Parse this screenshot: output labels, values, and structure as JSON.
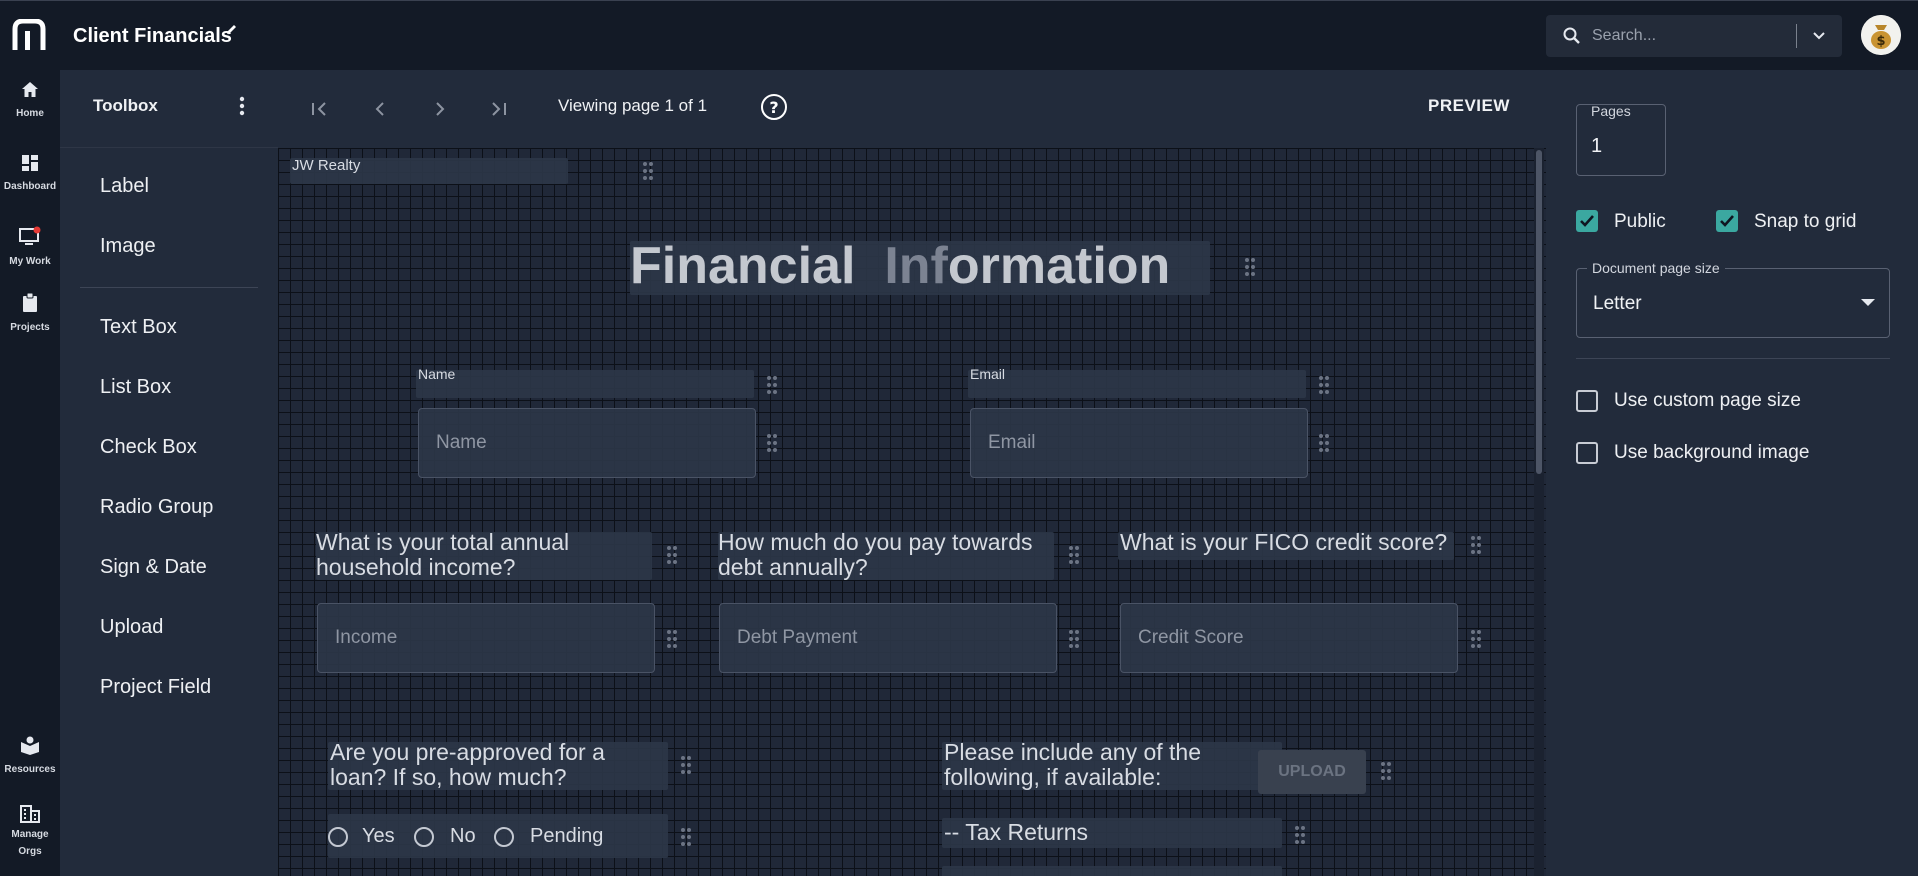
{
  "header": {
    "title": "Client Financials",
    "search_placeholder": "Search..."
  },
  "rail": {
    "items": [
      {
        "label": "Home",
        "icon": "home-icon"
      },
      {
        "label": "Dashboard",
        "icon": "dashboard-icon"
      },
      {
        "label": "My Work",
        "icon": "monitor-icon"
      },
      {
        "label": "Projects",
        "icon": "clipboard-icon"
      },
      {
        "label": "Resources",
        "icon": "book-icon"
      },
      {
        "label_line1": "Manage",
        "label_line2": "Orgs",
        "icon": "building-icon"
      }
    ]
  },
  "toolbox": {
    "title": "Toolbox",
    "items": [
      "Label",
      "Image",
      "Text Box",
      "List Box",
      "Check Box",
      "Radio Group",
      "Sign & Date",
      "Upload",
      "Project Field"
    ]
  },
  "canvas_header": {
    "page_info": "Viewing page 1 of 1",
    "preview_label": "PREVIEW"
  },
  "form": {
    "company": "JW Realty",
    "title_part1": "Financial",
    "title_part2": "Inf",
    "title_part3": "ormation",
    "name_label": "Name",
    "name_placeholder": "Name",
    "email_label": "Email",
    "email_placeholder": "Email",
    "income_question_line1": "What is your total annual",
    "income_question_line2": "household income?",
    "income_placeholder": "Income",
    "debt_question_line1": "How much do you pay towards",
    "debt_question_line2": "debt annually?",
    "debt_placeholder": "Debt Payment",
    "fico_question": "What is your FICO credit score?",
    "fico_placeholder": "Credit Score",
    "loan_question_line1": "Are you pre-approved for a",
    "loan_question_line2": "loan? If so, how much?",
    "radio_options": [
      "Yes",
      "No",
      "Pending"
    ],
    "include_line1": "Please include any of the",
    "include_line2": "following, if available:",
    "upload_label": "UPLOAD",
    "item_tax": "-- Tax Returns"
  },
  "properties": {
    "pages_label": "Pages",
    "pages_value": "1",
    "public_label": "Public",
    "public_checked": true,
    "snap_label": "Snap to grid",
    "snap_checked": true,
    "page_size_label": "Document page size",
    "page_size_value": "Letter",
    "custom_size_label": "Use custom page size",
    "custom_size_checked": false,
    "background_label": "Use background image",
    "background_checked": false
  },
  "colors": {
    "accent_checkbox": "#3ba8a0",
    "background": "#151b27",
    "panel": "#222b3b"
  }
}
